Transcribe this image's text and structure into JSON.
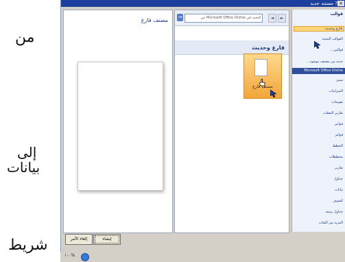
{
  "overlay": {
    "word1": "من",
    "word2": "إلى",
    "word3": "بيانات",
    "word4": "شريط"
  },
  "dialog": {
    "title": "مستند جديد",
    "help": "?",
    "close": "×"
  },
  "preview": {
    "title": "مصنف فارغ"
  },
  "middle": {
    "search_placeholder": "البحث في Microsoft Office Online عن",
    "go": "→",
    "back": "◄",
    "forward": "►",
    "section_title": "فارغ وحديث",
    "tile_caption": "مصنف فارغ"
  },
  "nav": {
    "header": "قوالب",
    "items_top": [
      "فارغ وحديث",
      "القوالب المثبتة",
      "قوالبي...",
      "جديد من مصنف موجود..."
    ],
    "banner": "Microsoft Office Online",
    "items_online": [
      "مميز",
      "الميزانيات",
      "تقويمات",
      "تقارير النفقات",
      "فواتير",
      "قوائم",
      "الخطط",
      "مخططات",
      "تقارير",
      "جداول",
      "بيانات",
      "كشوف",
      "جداول زمنية",
      "المزيد من الفئات"
    ]
  },
  "buttons": {
    "create": "إنشاء",
    "cancel": "إلغاء الأمر"
  },
  "taskbar": {
    "zoom": "١٠٠%"
  }
}
